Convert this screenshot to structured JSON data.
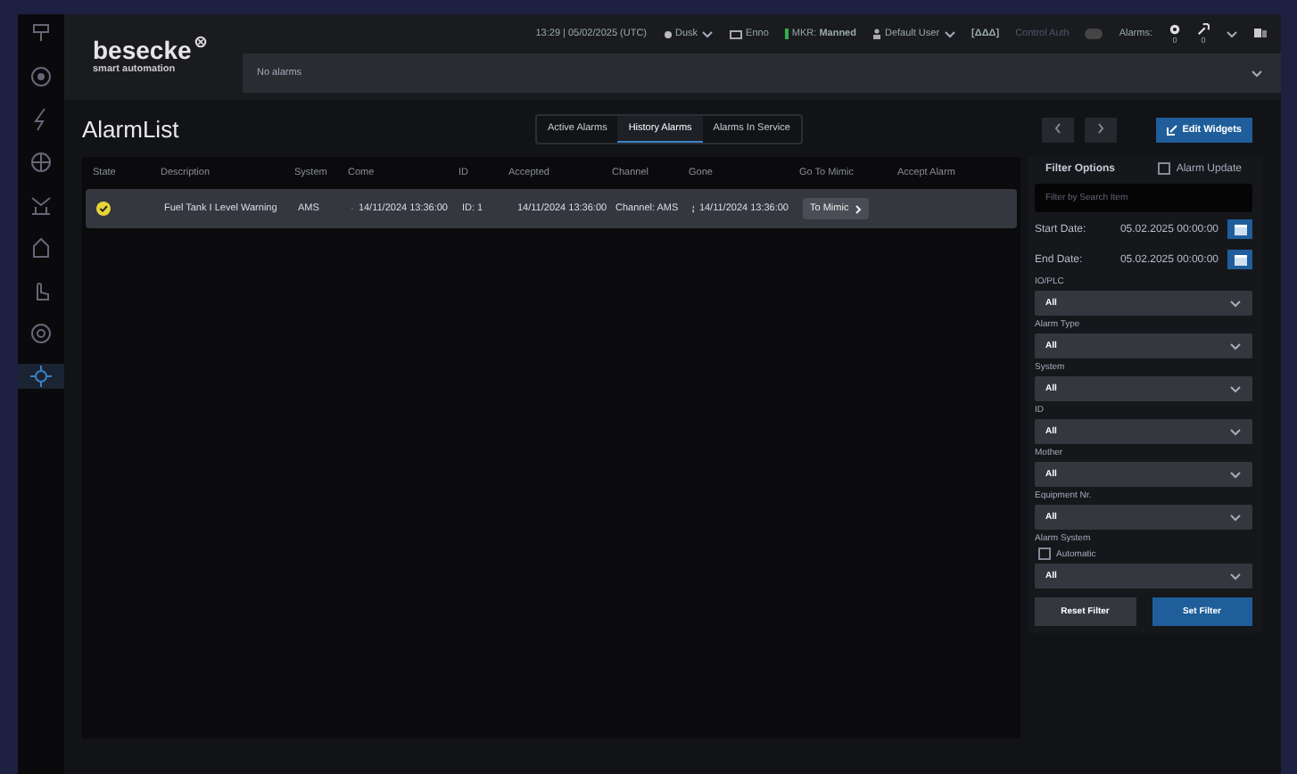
{
  "sidebar": {
    "items": [
      {
        "selected": false
      },
      {
        "selected": false
      },
      {
        "selected": false
      },
      {
        "selected": false
      },
      {
        "selected": false
      },
      {
        "selected": false
      },
      {
        "selected": false
      },
      {
        "selected": false
      },
      {
        "selected": true
      }
    ]
  },
  "logo": {
    "name": "besecke",
    "tagline": "smart automation"
  },
  "header": {
    "time": "13:29 | 05/02/2025 (UTC)",
    "mode": "Dusk",
    "screen": "Enno",
    "mkr": "MKR: **Manned**",
    "user": "Default User",
    "signal": "[ΔΔΔ]",
    "control_auth": {
      "label": "Control Auth",
      "on": false
    },
    "alarms_label": "Alarms:",
    "alarm_counts": [
      "0",
      "0"
    ]
  },
  "alarm_bar": {
    "text": "No alarms"
  },
  "page_title": "AlarmList",
  "tabs": [
    {
      "label": "Active Alarms",
      "selected": false
    },
    {
      "label": "History Alarms",
      "selected": true
    },
    {
      "label": "Alarms In Service",
      "selected": false
    }
  ],
  "table": {
    "columns": [
      "State",
      "Description",
      "System",
      "Come",
      "ID",
      "Accepted",
      "Channel",
      "Gone",
      "Go To Mimic",
      "Accept Alarm"
    ],
    "rows": [
      {
        "description": "Fuel Tank I Level Warning",
        "system": "AMS",
        "come": "14/11/2024 13:36:00",
        "id": "ID: 1",
        "accepted": "14/11/2024 13:36:00",
        "channel": "Channel: AMS",
        "gone": "14/11/2024 13:36:00",
        "mimic": "To Mimic"
      }
    ]
  },
  "edit_button": "Edit Widgets",
  "filter": {
    "title": "Filter Options",
    "alarm_update": {
      "label": "Alarm Update",
      "checked": false
    },
    "search": {
      "placeholder": "Filter by Search Item"
    },
    "dates": [
      {
        "label": "Start Date:",
        "value": "05.02.2025 00:00:00"
      },
      {
        "label": "End Date:",
        "value": "05.02.2025 00:00:00"
      }
    ],
    "selects": [
      {
        "label": "IO/PLC",
        "value": "All"
      },
      {
        "label": "Alarm Type",
        "value": "All"
      },
      {
        "label": "System",
        "value": "All"
      },
      {
        "label": "ID",
        "value": "All"
      },
      {
        "label": "Mother",
        "value": "All"
      },
      {
        "label": "Equipment Nr.",
        "value": "All"
      },
      {
        "label": "Alarm System",
        "value": "All",
        "automatic": {
          "label": "Automatic",
          "checked": false
        }
      }
    ],
    "reset": "Reset Filter",
    "set": "Set Filter"
  }
}
